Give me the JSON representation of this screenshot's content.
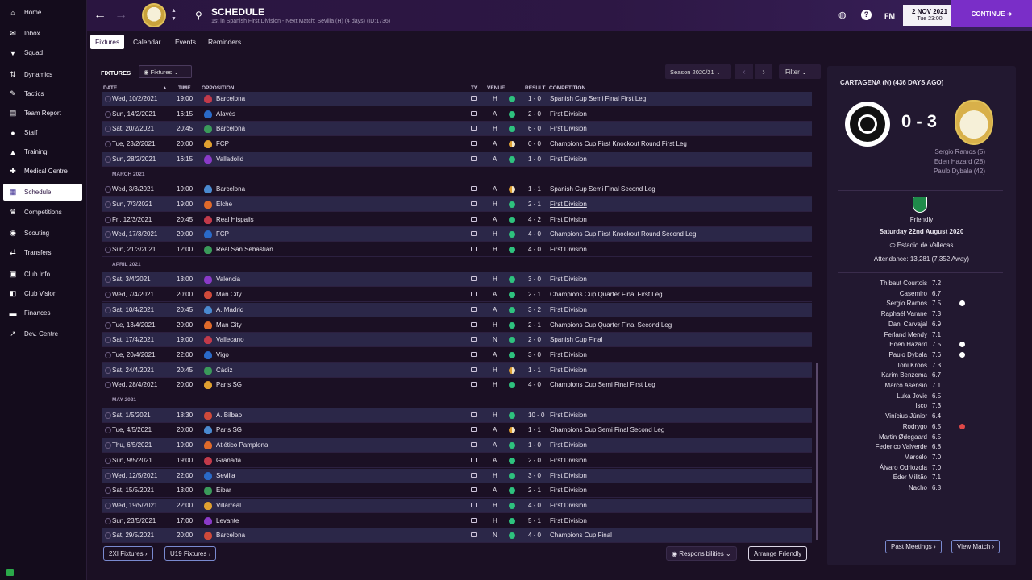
{
  "sidebar": {
    "items": [
      {
        "label": "Home",
        "icon": "home-icon"
      },
      {
        "label": "Inbox",
        "icon": "inbox-icon"
      },
      {
        "label": "Squad",
        "icon": "shirt-icon"
      },
      {
        "label": "Dynamics",
        "icon": "dynamics-icon"
      },
      {
        "label": "Tactics",
        "icon": "tactics-icon"
      },
      {
        "label": "Team Report",
        "icon": "report-icon"
      },
      {
        "label": "Staff",
        "icon": "staff-icon"
      },
      {
        "label": "Training",
        "icon": "training-icon"
      },
      {
        "label": "Medical Centre",
        "icon": "medical-icon"
      },
      {
        "label": "Schedule",
        "icon": "calendar-icon"
      },
      {
        "label": "Competitions",
        "icon": "trophy-icon"
      },
      {
        "label": "Scouting",
        "icon": "scouting-icon"
      },
      {
        "label": "Transfers",
        "icon": "transfers-icon"
      },
      {
        "label": "Club Info",
        "icon": "club-info-icon"
      },
      {
        "label": "Club Vision",
        "icon": "club-vision-icon"
      },
      {
        "label": "Finances",
        "icon": "finances-icon"
      },
      {
        "label": "Dev. Centre",
        "icon": "dev-centre-icon"
      }
    ]
  },
  "header": {
    "title": "SCHEDULE",
    "subtitle": "1st in Spanish First Division - Next Match: Sevilla (H) (4 days) (ID:1736)",
    "fm_label": "FM",
    "date_main": "2 NOV 2021",
    "date_sub": "Tue 23:00",
    "continue_label": "CONTINUE"
  },
  "tabs": [
    {
      "label": "Fixtures"
    },
    {
      "label": "Calendar"
    },
    {
      "label": "Events"
    },
    {
      "label": "Reminders"
    }
  ],
  "toolbar": {
    "fixtures_label": "FIXTURES",
    "fixtures_filter": "Fixtures",
    "season": "Season 2020/21",
    "filter": "Filter"
  },
  "columns": {
    "date": "DATE",
    "time": "TIME",
    "opposition": "OPPOSITION",
    "tv": "TV",
    "venue": "VENUE",
    "result": "RESULT",
    "competition": "COMPETITION"
  },
  "rows": [
    {
      "date": "Wed, 10/2/2021",
      "time": "19:00",
      "opp": "Barcelona",
      "venue": "H",
      "res": "win",
      "score": "1 - 0",
      "comp": "Spanish Cup Semi Final First Leg"
    },
    {
      "date": "Sun, 14/2/2021",
      "time": "16:15",
      "opp": "Alavés",
      "venue": "A",
      "res": "win",
      "score": "2 - 0",
      "comp": "First Division"
    },
    {
      "date": "Sat, 20/2/2021",
      "time": "20:45",
      "opp": "Barcelona",
      "venue": "H",
      "res": "win",
      "score": "6 - 0",
      "comp": "First Division"
    },
    {
      "date": "Tue, 23/2/2021",
      "time": "20:00",
      "opp": "FCP",
      "venue": "A",
      "res": "draw",
      "score": "0 - 0",
      "comp_link": "Champions Cup",
      "comp": " First Knockout Round First Leg"
    },
    {
      "date": "Sun, 28/2/2021",
      "time": "16:15",
      "opp": "Valladolid",
      "venue": "A",
      "res": "win",
      "score": "1 - 0",
      "comp": "First Division"
    },
    {
      "month": "MARCH 2021"
    },
    {
      "date": "Wed, 3/3/2021",
      "time": "19:00",
      "opp": "Barcelona",
      "venue": "A",
      "res": "draw",
      "score": "1 - 1",
      "comp": "Spanish Cup Semi Final Second Leg"
    },
    {
      "date": "Sun, 7/3/2021",
      "time": "19:00",
      "opp": "Elche",
      "venue": "H",
      "res": "win",
      "score": "2 - 1",
      "comp_link": "First Division",
      "comp": ""
    },
    {
      "date": "Fri, 12/3/2021",
      "time": "20:45",
      "opp": "Real Hispalis",
      "venue": "A",
      "res": "win",
      "score": "4 - 2",
      "comp": "First Division"
    },
    {
      "date": "Wed, 17/3/2021",
      "time": "20:00",
      "opp": "FCP",
      "venue": "H",
      "res": "win",
      "score": "4 - 0",
      "comp": "Champions Cup First Knockout Round Second Leg"
    },
    {
      "date": "Sun, 21/3/2021",
      "time": "12:00",
      "opp": "Real San Sebastián",
      "venue": "H",
      "res": "win",
      "score": "4 - 0",
      "comp": "First Division"
    },
    {
      "month": "APRIL 2021"
    },
    {
      "date": "Sat, 3/4/2021",
      "time": "13:00",
      "opp": "Valencia",
      "venue": "H",
      "res": "win",
      "score": "3 - 0",
      "comp": "First Division"
    },
    {
      "date": "Wed, 7/4/2021",
      "time": "20:00",
      "opp": "Man City",
      "venue": "A",
      "res": "win",
      "score": "2 - 1",
      "comp": "Champions Cup Quarter Final First Leg"
    },
    {
      "date": "Sat, 10/4/2021",
      "time": "20:45",
      "opp": "A. Madrid",
      "venue": "A",
      "res": "win",
      "score": "3 - 2",
      "comp": "First Division"
    },
    {
      "date": "Tue, 13/4/2021",
      "time": "20:00",
      "opp": "Man City",
      "venue": "H",
      "res": "win",
      "score": "2 - 1",
      "comp": "Champions Cup Quarter Final Second Leg"
    },
    {
      "date": "Sat, 17/4/2021",
      "time": "19:00",
      "opp": "Vallecano",
      "venue": "N",
      "res": "win",
      "score": "2 - 0",
      "comp": "Spanish Cup Final"
    },
    {
      "date": "Tue, 20/4/2021",
      "time": "22:00",
      "opp": "Vigo",
      "venue": "A",
      "res": "win",
      "score": "3 - 0",
      "comp": "First Division"
    },
    {
      "date": "Sat, 24/4/2021",
      "time": "20:45",
      "opp": "Cádiz",
      "venue": "H",
      "res": "draw",
      "score": "1 - 1",
      "comp": "First Division"
    },
    {
      "date": "Wed, 28/4/2021",
      "time": "20:00",
      "opp": "Paris SG",
      "venue": "H",
      "res": "win",
      "score": "4 - 0",
      "comp": "Champions Cup Semi Final First Leg"
    },
    {
      "month": "MAY 2021"
    },
    {
      "date": "Sat, 1/5/2021",
      "time": "18:30",
      "opp": "A. Bilbao",
      "venue": "H",
      "res": "win",
      "score": "10 - 0",
      "comp": "First Division"
    },
    {
      "date": "Tue, 4/5/2021",
      "time": "20:00",
      "opp": "Paris SG",
      "venue": "A",
      "res": "draw",
      "score": "1 - 1",
      "comp": "Champions Cup Semi Final Second Leg"
    },
    {
      "date": "Thu, 6/5/2021",
      "time": "19:00",
      "opp": "Atlético Pamplona",
      "venue": "A",
      "res": "win",
      "score": "1 - 0",
      "comp": "First Division"
    },
    {
      "date": "Sun, 9/5/2021",
      "time": "19:00",
      "opp": "Granada",
      "venue": "A",
      "res": "win",
      "score": "2 - 0",
      "comp": "First Division"
    },
    {
      "date": "Wed, 12/5/2021",
      "time": "22:00",
      "opp": "Sevilla",
      "venue": "H",
      "res": "win",
      "score": "3 - 0",
      "comp": "First Division"
    },
    {
      "date": "Sat, 15/5/2021",
      "time": "13:00",
      "opp": "Eibar",
      "venue": "A",
      "res": "win",
      "score": "2 - 1",
      "comp": "First Division"
    },
    {
      "date": "Wed, 19/5/2021",
      "time": "22:00",
      "opp": "Villarreal",
      "venue": "H",
      "res": "win",
      "score": "4 - 0",
      "comp": "First Division"
    },
    {
      "date": "Sun, 23/5/2021",
      "time": "17:00",
      "opp": "Levante",
      "venue": "H",
      "res": "win",
      "score": "5 - 1",
      "comp": "First Division"
    },
    {
      "date": "Sat, 29/5/2021",
      "time": "20:00",
      "opp": "Barcelona",
      "venue": "N",
      "res": "win",
      "score": "4 - 0",
      "comp": "Champions Cup Final"
    }
  ],
  "colors": {
    "win": "#2ec27e",
    "draw": "#e0a030",
    "accent": "#7a2ec8"
  },
  "bottom": {
    "btn_2xi": "2XI Fixtures",
    "btn_u19": "U19 Fixtures",
    "responsibilities": "Responsibilities",
    "arrange": "Arrange Friendly"
  },
  "panel": {
    "header": "CARTAGENA (N) (436 DAYS AGO)",
    "score": "0 - 3",
    "scorers": [
      "Sergio Ramos (5)",
      "Eden Hazard (28)",
      "Paulo Dybala (42)"
    ],
    "competition": "Friendly",
    "match_date": "Saturday 22nd August 2020",
    "stadium": "Estadio de Vallecas",
    "attendance": "Attendance: 13,281 (7,352 Away)",
    "players": [
      {
        "name": "Thibaut Courtois",
        "rating": "7.2",
        "ev": ""
      },
      {
        "name": "Casemiro",
        "rating": "6.7",
        "ev": ""
      },
      {
        "name": "Sergio Ramos",
        "rating": "7.5",
        "ev": "goal"
      },
      {
        "name": "Raphaël Varane",
        "rating": "7.3",
        "ev": ""
      },
      {
        "name": "Dani Carvajal",
        "rating": "6.9",
        "ev": ""
      },
      {
        "name": "Ferland Mendy",
        "rating": "7.1",
        "ev": ""
      },
      {
        "name": "Eden Hazard",
        "rating": "7.5",
        "ev": "goal"
      },
      {
        "name": "Paulo Dybala",
        "rating": "7.6",
        "ev": "goal"
      },
      {
        "name": "Toni Kroos",
        "rating": "7.3",
        "ev": ""
      },
      {
        "name": "Karim Benzema",
        "rating": "6.7",
        "ev": ""
      },
      {
        "name": "Marco Asensio",
        "rating": "7.1",
        "ev": ""
      },
      {
        "name": "Luka Jovic",
        "rating": "6.5",
        "ev": ""
      },
      {
        "name": "Isco",
        "rating": "7.3",
        "ev": ""
      },
      {
        "name": "Vinícius Júnior",
        "rating": "6.4",
        "ev": ""
      },
      {
        "name": "Rodrygo",
        "rating": "6.5",
        "ev": "red"
      },
      {
        "name": "Martin Ødegaard",
        "rating": "6.5",
        "ev": ""
      },
      {
        "name": "Federico Valverde",
        "rating": "6.8",
        "ev": ""
      },
      {
        "name": "Marcelo",
        "rating": "7.0",
        "ev": ""
      },
      {
        "name": "Álvaro Odriozola",
        "rating": "7.0",
        "ev": ""
      },
      {
        "name": "Éder Militão",
        "rating": "7.1",
        "ev": ""
      },
      {
        "name": "Nacho",
        "rating": "6.8",
        "ev": ""
      }
    ],
    "past_meetings": "Past Meetings",
    "view_match": "View Match"
  }
}
